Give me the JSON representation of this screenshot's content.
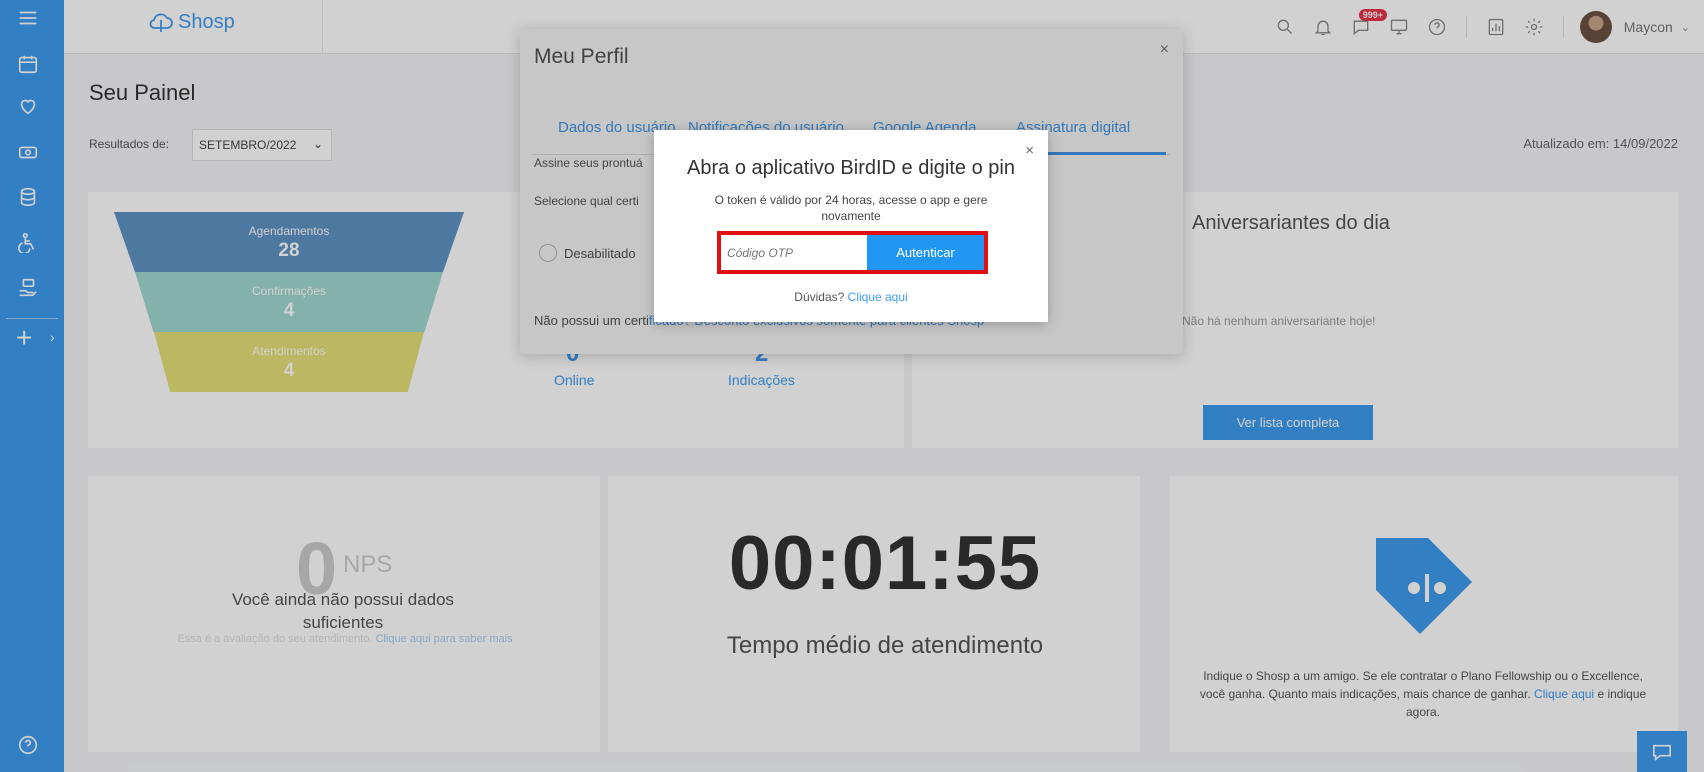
{
  "app": {
    "logo_text": "Shosp"
  },
  "sidebar": {
    "items": [
      {
        "icon": "menu-icon"
      },
      {
        "icon": "calendar-icon"
      },
      {
        "icon": "heart-icon"
      },
      {
        "icon": "money-icon"
      },
      {
        "icon": "database-icon"
      },
      {
        "icon": "accessibility-icon"
      },
      {
        "icon": "hand-money-icon"
      },
      {
        "icon": "plus-icon"
      },
      {
        "icon": "help-icon"
      }
    ]
  },
  "topbar": {
    "notification_badge": "999+",
    "username": "Maycon",
    "icons": [
      "search-icon",
      "bell-icon",
      "chat-icon",
      "monitor-icon",
      "help-icon",
      "report-icon",
      "gear-icon"
    ]
  },
  "page": {
    "title": "Seu Painel",
    "results_label": "Resultados de:",
    "month_value": "SETEMBRO/2022",
    "updated": "Atualizado em: 14/09/2022"
  },
  "funnel": [
    {
      "label": "Agendamentos",
      "value": "28",
      "color": "#5f93c4"
    },
    {
      "label": "Confirmações",
      "value": "4",
      "color": "#9fd9cf"
    },
    {
      "label": "Atendimentos",
      "value": "4",
      "color": "#e5e078"
    }
  ],
  "stats": [
    {
      "value": "0",
      "label": "Online"
    },
    {
      "value": "2",
      "label": "Indicações"
    }
  ],
  "birthdays": {
    "title": "Aniversariantes do dia",
    "empty_text": "Não há nenhum aniversariante hoje!",
    "button": "Ver lista completa"
  },
  "nps": {
    "value": "0",
    "label": "NPS",
    "message": "Você ainda não possui dados suficientes",
    "sub_text": "Essa é a avaliação do seu atendimento.",
    "sub_link": "Clique aqui para saber mais"
  },
  "timer": {
    "value": "00:01:55",
    "label": "Tempo médio de atendimento"
  },
  "referral": {
    "text": "Indique o Shosp a um amigo. Se ele contratar o Plano Fellowship ou o Excellence, você ganha. Quanto mais indicações, mais chance de ganhar.",
    "link": "Clique aqui",
    "text_end": "e indique agora."
  },
  "profile_modal": {
    "title": "Meu Perfil",
    "close": "×",
    "tabs": [
      "Dados do usuário",
      "Notificações do usuário",
      "Google Agenda",
      "Assinatura digital"
    ],
    "active_tab": 3,
    "line1": "Assine seus prontuá",
    "line2": "Selecione qual certi",
    "radio_label": "Desabilitado",
    "line3_prefix": "Não possui um certi",
    "line3_link": "ficado? Desconto exclusivos somente para clientes Shosp"
  },
  "otp_dialog": {
    "close": "×",
    "title": "Abra o aplicativo BirdID e digite o pin",
    "subtitle": "O token é válido por 24 horas, acesse o app e gere novamente",
    "input_placeholder": "Código OTP",
    "button": "Autenticar",
    "help_text": "Dúvidas?",
    "help_link": "Clique aqui"
  },
  "colors": {
    "primary": "#3f9bf0",
    "highlight_border": "#e01010"
  }
}
